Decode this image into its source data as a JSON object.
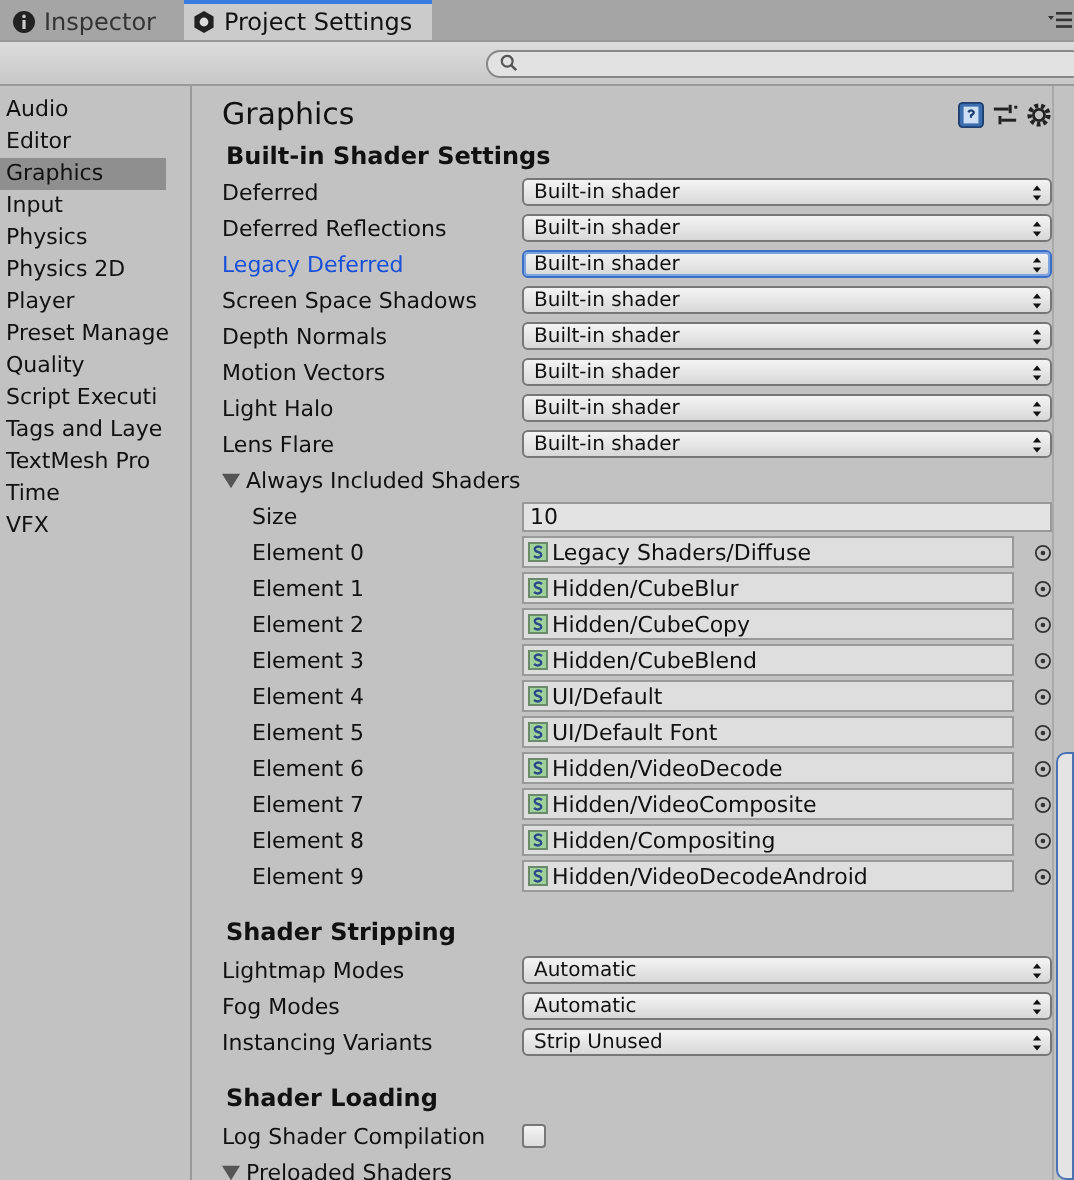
{
  "tabs": [
    {
      "label": "Inspector",
      "kind": "info",
      "selected": false
    },
    {
      "label": "Project Settings",
      "kind": "gear",
      "selected": true
    }
  ],
  "sidebar": {
    "items": [
      {
        "label": "Audio",
        "selected": false
      },
      {
        "label": "Editor",
        "selected": false
      },
      {
        "label": "Graphics",
        "selected": true
      },
      {
        "label": "Input",
        "selected": false
      },
      {
        "label": "Physics",
        "selected": false
      },
      {
        "label": "Physics 2D",
        "selected": false
      },
      {
        "label": "Player",
        "selected": false
      },
      {
        "label": "Preset Manage",
        "selected": false
      },
      {
        "label": "Quality",
        "selected": false
      },
      {
        "label": "Script Executi",
        "selected": false
      },
      {
        "label": "Tags and Laye",
        "selected": false
      },
      {
        "label": "TextMesh Pro",
        "selected": false
      },
      {
        "label": "Time",
        "selected": false
      },
      {
        "label": "VFX",
        "selected": false
      }
    ]
  },
  "page_title": "Graphics",
  "builtin": {
    "title": "Built-in Shader Settings",
    "rows": [
      {
        "label": "Deferred",
        "value": "Built-in shader",
        "focused": false
      },
      {
        "label": "Deferred Reflections",
        "value": "Built-in shader",
        "focused": false
      },
      {
        "label": "Legacy Deferred",
        "value": "Built-in shader",
        "focused": true
      },
      {
        "label": "Screen Space Shadows",
        "value": "Built-in shader",
        "focused": false
      },
      {
        "label": "Depth Normals",
        "value": "Built-in shader",
        "focused": false
      },
      {
        "label": "Motion Vectors",
        "value": "Built-in shader",
        "focused": false
      },
      {
        "label": "Light Halo",
        "value": "Built-in shader",
        "focused": false
      },
      {
        "label": "Lens Flare",
        "value": "Built-in shader",
        "focused": false
      }
    ],
    "always_included": {
      "label": "Always Included Shaders",
      "expanded": true,
      "size_label": "Size",
      "size": "10",
      "elements": [
        {
          "label": "Element 0",
          "value": "Legacy Shaders/Diffuse"
        },
        {
          "label": "Element 1",
          "value": "Hidden/CubeBlur"
        },
        {
          "label": "Element 2",
          "value": "Hidden/CubeCopy"
        },
        {
          "label": "Element 3",
          "value": "Hidden/CubeBlend"
        },
        {
          "label": "Element 4",
          "value": "UI/Default"
        },
        {
          "label": "Element 5",
          "value": "UI/Default Font"
        },
        {
          "label": "Element 6",
          "value": "Hidden/VideoDecode"
        },
        {
          "label": "Element 7",
          "value": "Hidden/VideoComposite"
        },
        {
          "label": "Element 8",
          "value": "Hidden/Compositing"
        },
        {
          "label": "Element 9",
          "value": "Hidden/VideoDecodeAndroid"
        }
      ]
    }
  },
  "stripping": {
    "title": "Shader Stripping",
    "rows": [
      {
        "label": "Lightmap Modes",
        "value": "Automatic",
        "focused": false
      },
      {
        "label": "Fog Modes",
        "value": "Automatic",
        "focused": false
      },
      {
        "label": "Instancing Variants",
        "value": "Strip Unused",
        "focused": false
      }
    ]
  },
  "loading": {
    "title": "Shader Loading",
    "log": {
      "label": "Log Shader Compilation",
      "checked": false
    },
    "preloaded": {
      "label": "Preloaded Shaders",
      "expanded": true
    }
  }
}
